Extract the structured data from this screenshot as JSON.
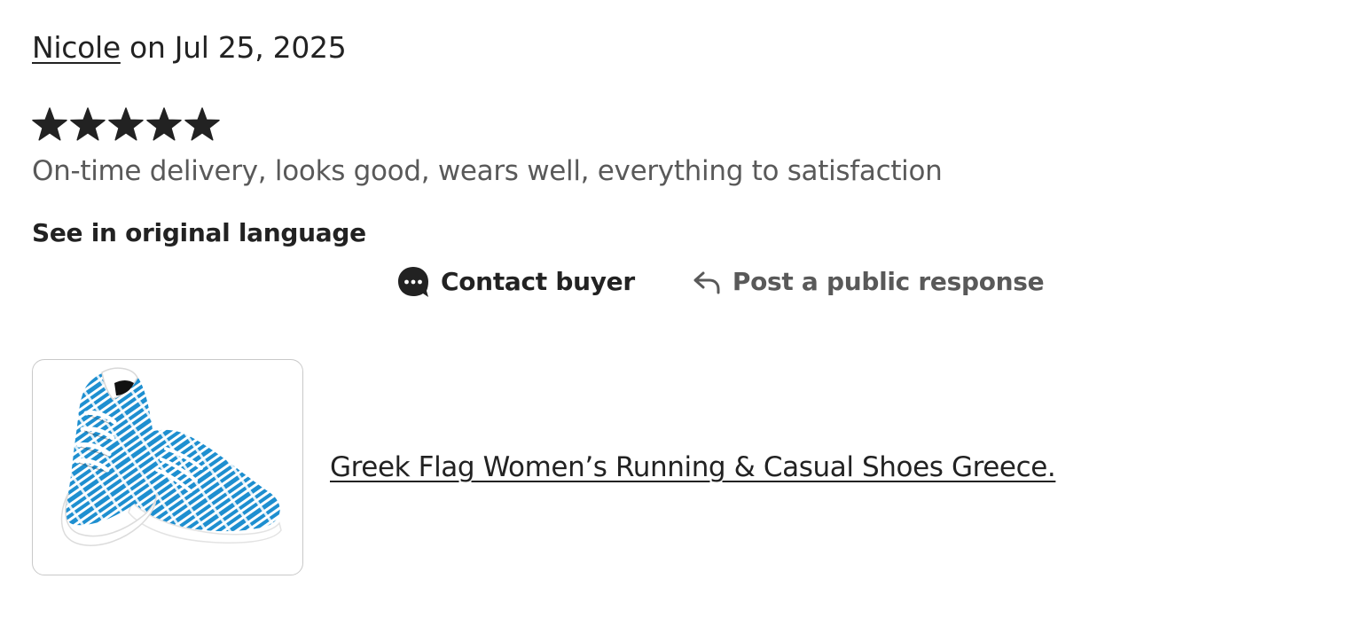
{
  "review": {
    "reviewer_name": "Nicole",
    "date_text": " on Jul 25, 2025",
    "rating": 5,
    "rating_max": 5,
    "text": "On-time delivery, looks good, wears well, everything to satisfaction",
    "see_original_label": "See in original language"
  },
  "actions": {
    "contact_label": "Contact buyer",
    "contact_icon": "chat-bubble-icon",
    "response_label": "Post a public response",
    "response_icon": "reply-arrow-icon"
  },
  "listing": {
    "title": "Greek Flag Women’s Running & Casual Shoes Greece.",
    "thumbnail_alt": "Greek Flag Women’s Running & Casual Shoes Greece."
  },
  "colors": {
    "text_primary": "#222222",
    "text_secondary": "#595959",
    "star": "#222222",
    "shoe_blue": "#1e8fd0",
    "thumb_border": "#c9c9c9"
  }
}
